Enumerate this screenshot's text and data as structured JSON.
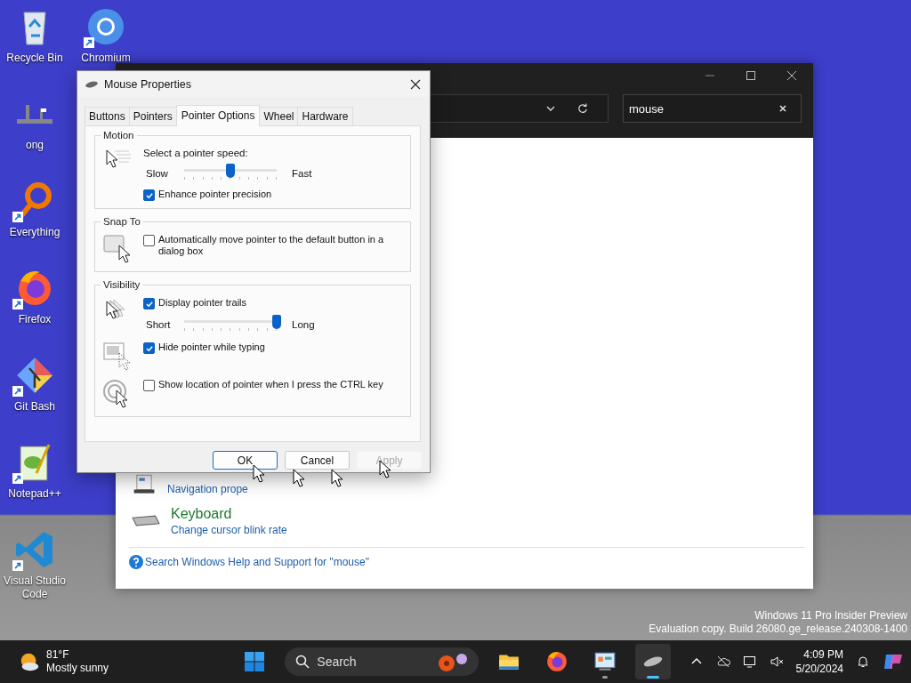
{
  "desktop": {
    "icons": [
      {
        "label": "Recycle Bin",
        "kind": "recycle",
        "shortcut": false
      },
      {
        "label": "ong",
        "kind": "dock",
        "shortcut": false
      },
      {
        "label": "Everything",
        "kind": "magnifier",
        "shortcut": true
      },
      {
        "label": "Firefox",
        "kind": "firefox",
        "shortcut": true
      },
      {
        "label": "Git Bash",
        "kind": "git",
        "shortcut": true
      },
      {
        "label": "Notepad++",
        "kind": "notepad",
        "shortcut": true
      },
      {
        "label": "Visual Studio Code",
        "kind": "vscode",
        "shortcut": true
      },
      {
        "label": "Chromium",
        "kind": "chromium",
        "shortcut": true
      }
    ]
  },
  "explorer": {
    "search": {
      "value": "mouse"
    },
    "results": [
      {
        "kind": "taskbar",
        "links": [
          "Navigation prope"
        ]
      },
      {
        "kind": "keyboard",
        "heading": "Keyboard",
        "links": [
          "Change cursor blink rate"
        ]
      }
    ],
    "help_link": "Search Windows Help and Support for \"mouse\""
  },
  "dialog": {
    "title": "Mouse Properties",
    "tabs": [
      {
        "label": "Buttons",
        "selected": false
      },
      {
        "label": "Pointers",
        "selected": false
      },
      {
        "label": "Pointer Options",
        "selected": true
      },
      {
        "label": "Wheel",
        "selected": false
      },
      {
        "label": "Hardware",
        "selected": false
      }
    ],
    "groups": [
      {
        "title": "Motion",
        "sections": [
          {
            "kind": "speed",
            "rows": [
              {
                "kind": "label",
                "text": "Select a pointer speed:"
              },
              {
                "kind": "slider",
                "min_label": "Slow",
                "max_label": "Fast",
                "level": 0.5
              },
              {
                "kind": "checkbox",
                "label": "Enhance pointer precision",
                "checked": true
              }
            ]
          }
        ]
      },
      {
        "title": "Snap To",
        "sections": [
          {
            "kind": "snap",
            "rows": [
              {
                "kind": "checkbox",
                "label": "Automatically move pointer to the default button in a dialog box",
                "checked": false
              }
            ]
          }
        ]
      },
      {
        "title": "Visibility",
        "sections": [
          {
            "kind": "trails",
            "rows": [
              {
                "kind": "checkbox",
                "label": "Display pointer trails",
                "checked": true
              },
              {
                "kind": "slider",
                "min_label": "Short",
                "max_label": "Long",
                "level": 1
              }
            ]
          },
          {
            "kind": "hide",
            "rows": [
              {
                "kind": "checkbox",
                "label": "Hide pointer while typing",
                "checked": true
              }
            ]
          },
          {
            "kind": "locate",
            "rows": [
              {
                "kind": "checkbox",
                "label": "Show location of pointer when I press the CTRL key",
                "checked": false
              }
            ]
          }
        ]
      }
    ],
    "buttons": [
      {
        "label": "OK",
        "default": true,
        "disabled": false
      },
      {
        "label": "Cancel",
        "default": false,
        "disabled": false
      },
      {
        "label": "Apply",
        "default": false,
        "disabled": true
      }
    ]
  },
  "watermark": [
    "Windows 11 Pro Insider Preview",
    "Evaluation copy. Build 26080.ge_release.240308-1400"
  ],
  "taskbar": {
    "weather": {
      "temperature": "81°F",
      "condition": "Mostly sunny"
    },
    "search": {
      "placeholder": "Search"
    },
    "apps": [
      {
        "kind": "explorer",
        "running": false,
        "selected": false
      },
      {
        "kind": "firefox",
        "running": false,
        "selected": false
      },
      {
        "kind": "control",
        "running": true,
        "selected": false
      },
      {
        "kind": "mouse",
        "running": true,
        "selected": true
      }
    ],
    "clock": {
      "time": "4:09 PM",
      "date": "5/20/2024"
    }
  }
}
